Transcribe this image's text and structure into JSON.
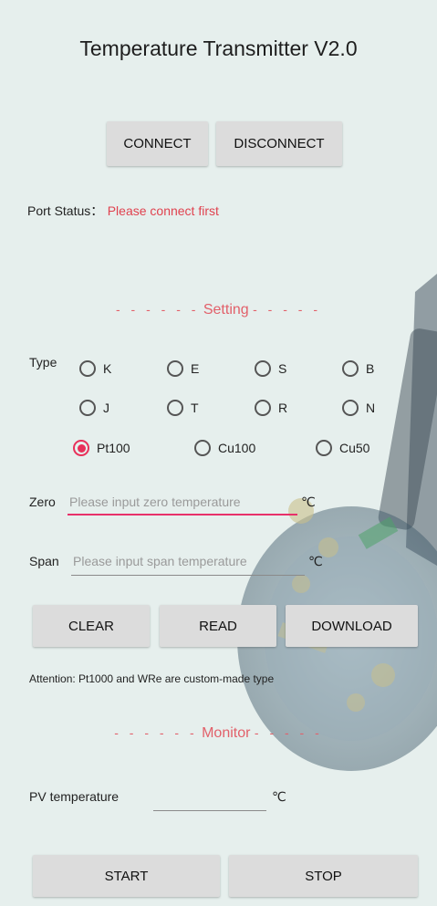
{
  "app": {
    "title": "Temperature Transmitter V2.0"
  },
  "connection": {
    "connect_label": "CONNECT",
    "disconnect_label": "DISCONNECT",
    "port_status_label": "Port Status：",
    "port_status_value": "Please connect first"
  },
  "setting": {
    "header": "Setting",
    "type_label": "Type",
    "types": [
      {
        "label": "K",
        "selected": false
      },
      {
        "label": "E",
        "selected": false
      },
      {
        "label": "S",
        "selected": false
      },
      {
        "label": "B",
        "selected": false
      },
      {
        "label": "J",
        "selected": false
      },
      {
        "label": "T",
        "selected": false
      },
      {
        "label": "R",
        "selected": false
      },
      {
        "label": "N",
        "selected": false
      },
      {
        "label": "Pt100",
        "selected": true
      },
      {
        "label": "Cu100",
        "selected": false
      },
      {
        "label": "Cu50",
        "selected": false
      }
    ],
    "zero_label": "Zero",
    "zero_placeholder": "Please input zero temperature",
    "zero_unit": "℃",
    "span_label": "Span",
    "span_placeholder": "Please input span temperature",
    "span_unit": "℃",
    "clear_label": "CLEAR",
    "read_label": "READ",
    "download_label": "DOWNLOAD",
    "attention": "Attention: Pt1000 and WRe are custom-made type"
  },
  "monitor": {
    "header": "Monitor",
    "pv_label": "PV temperature",
    "pv_value": "",
    "pv_unit": "℃",
    "start_label": "START",
    "stop_label": "STOP"
  },
  "colors": {
    "accent": "#e8305a",
    "background": "#e6efed",
    "button": "#dcdcdc"
  }
}
